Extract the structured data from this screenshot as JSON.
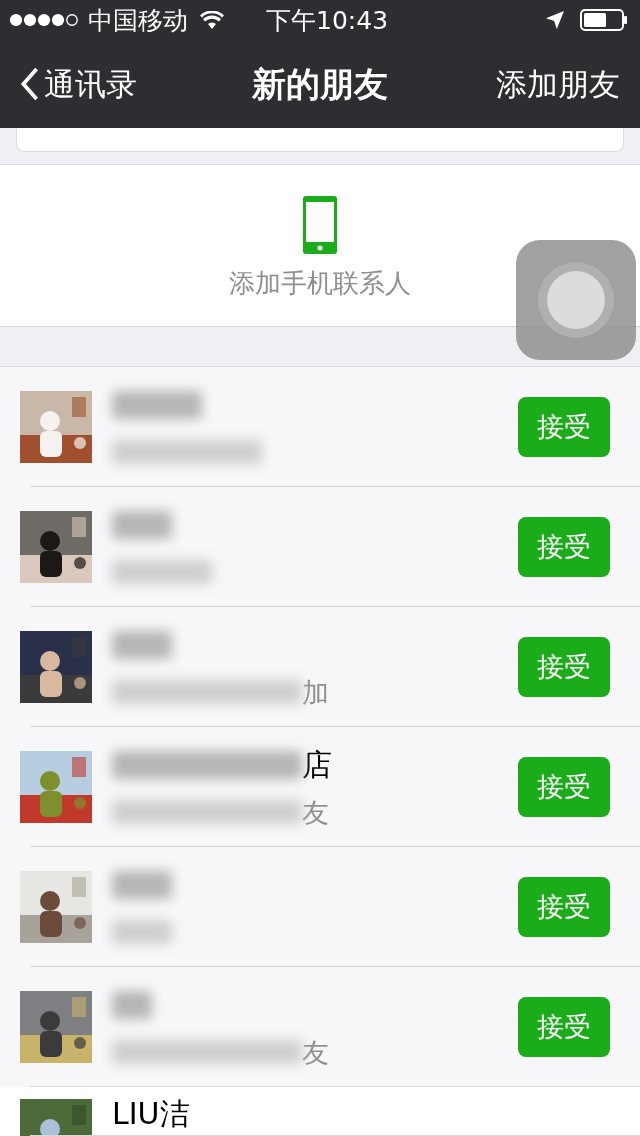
{
  "status_bar": {
    "carrier": "中国移动",
    "time": "下午10:43"
  },
  "nav": {
    "back": "通讯录",
    "title": "新的朋友",
    "action": "添加朋友"
  },
  "add_phone_contacts": "添加手机联系人",
  "requests": [
    {
      "unread": true,
      "button": "接受"
    },
    {
      "unread": true,
      "button": "接受"
    },
    {
      "unread": true,
      "message": "加",
      "button": "接受"
    },
    {
      "unread": true,
      "name": "店",
      "message": "友",
      "button": "接受"
    },
    {
      "unread": true,
      "button": "接受"
    },
    {
      "unread": true,
      "message": "友",
      "button": "接受"
    },
    {
      "unread": false,
      "name": "LIU洁"
    }
  ]
}
